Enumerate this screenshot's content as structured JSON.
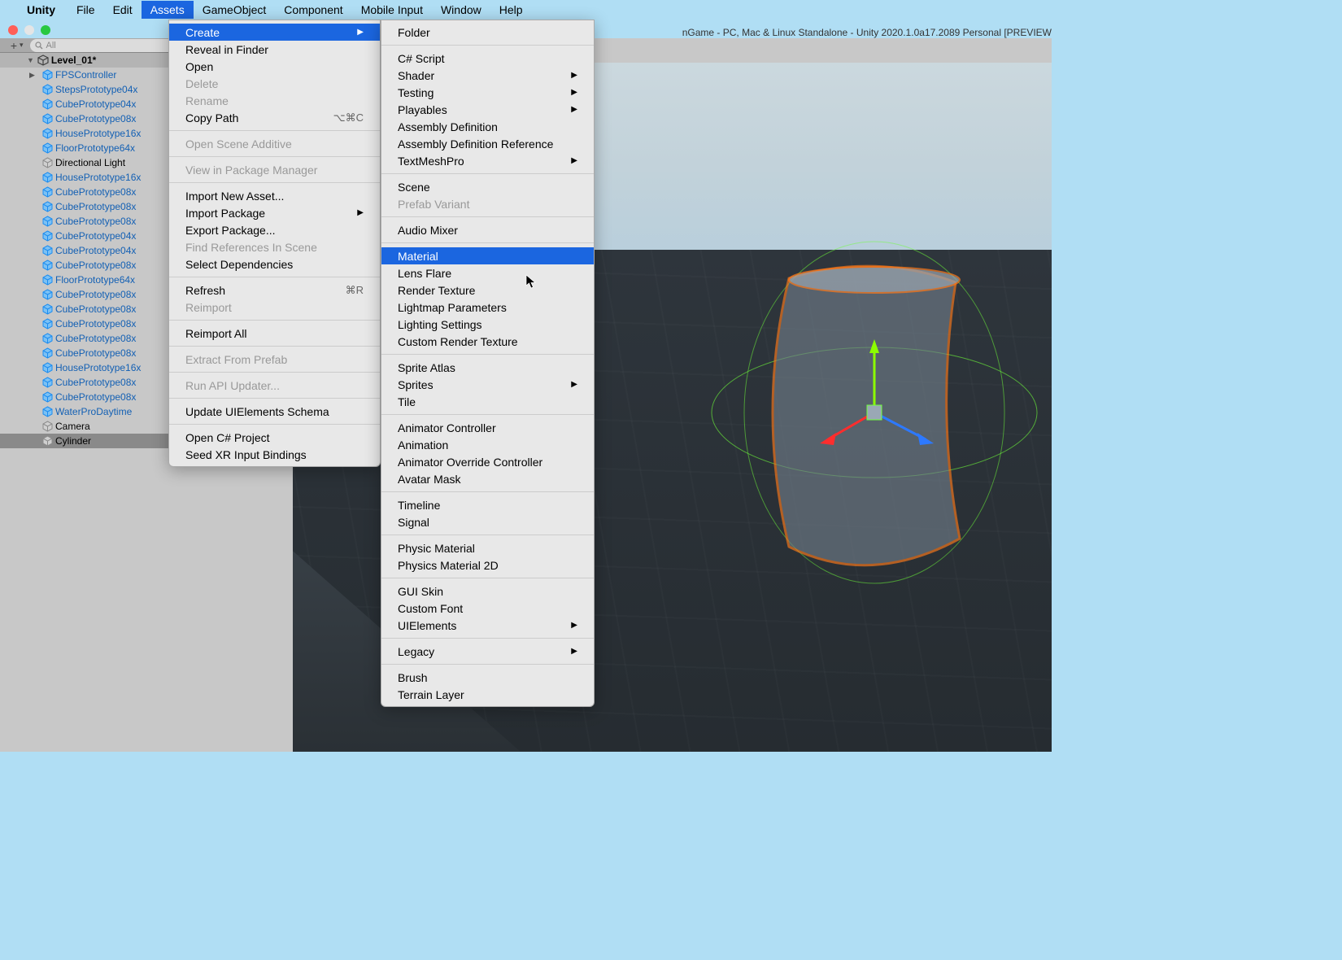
{
  "menubar": {
    "app_name": "Unity",
    "items": [
      "File",
      "Edit",
      "Assets",
      "GameObject",
      "Component",
      "Mobile Input",
      "Window",
      "Help"
    ],
    "active": "Assets"
  },
  "window_title": "nGame - PC, Mac & Linux Standalone - Unity 2020.1.0a17.2089 Personal [PREVIEW",
  "hierarchy": {
    "search_placeholder": "All",
    "scene_name": "Level_01*",
    "items": [
      {
        "label": "FPSController",
        "icon": "prefab",
        "has_children": true
      },
      {
        "label": "StepsPrototype04x",
        "icon": "prefab"
      },
      {
        "label": "CubePrototype04x",
        "icon": "prefab"
      },
      {
        "label": "CubePrototype08x",
        "icon": "prefab"
      },
      {
        "label": "HousePrototype16x",
        "icon": "prefab"
      },
      {
        "label": "FloorPrototype64x",
        "icon": "prefab"
      },
      {
        "label": "Directional Light",
        "icon": "go"
      },
      {
        "label": "HousePrototype16x",
        "icon": "prefab"
      },
      {
        "label": "CubePrototype08x",
        "icon": "prefab"
      },
      {
        "label": "CubePrototype08x",
        "icon": "prefab"
      },
      {
        "label": "CubePrototype08x",
        "icon": "prefab"
      },
      {
        "label": "CubePrototype04x",
        "icon": "prefab"
      },
      {
        "label": "CubePrototype04x",
        "icon": "prefab"
      },
      {
        "label": "CubePrototype08x",
        "icon": "prefab"
      },
      {
        "label": "FloorPrototype64x",
        "icon": "prefab"
      },
      {
        "label": "CubePrototype08x",
        "icon": "prefab"
      },
      {
        "label": "CubePrototype08x",
        "icon": "prefab"
      },
      {
        "label": "CubePrototype08x",
        "icon": "prefab"
      },
      {
        "label": "CubePrototype08x",
        "icon": "prefab"
      },
      {
        "label": "CubePrototype08x",
        "icon": "prefab"
      },
      {
        "label": "HousePrototype16x",
        "icon": "prefab"
      },
      {
        "label": "CubePrototype08x",
        "icon": "prefab"
      },
      {
        "label": "CubePrototype08x",
        "icon": "prefab"
      },
      {
        "label": "WaterProDaytime",
        "icon": "prefab"
      },
      {
        "label": "Camera",
        "icon": "go"
      },
      {
        "label": "Cylinder",
        "icon": "go",
        "selected": true
      }
    ]
  },
  "assets_menu": [
    {
      "label": "Create",
      "submenu": true,
      "highlighted": true
    },
    {
      "label": "Reveal in Finder"
    },
    {
      "label": "Open"
    },
    {
      "label": "Delete",
      "disabled": true
    },
    {
      "label": "Rename",
      "disabled": true
    },
    {
      "label": "Copy Path",
      "shortcut": "⌥⌘C"
    },
    {
      "separator": true
    },
    {
      "label": "Open Scene Additive",
      "disabled": true
    },
    {
      "separator": true
    },
    {
      "label": "View in Package Manager",
      "disabled": true
    },
    {
      "separator": true
    },
    {
      "label": "Import New Asset..."
    },
    {
      "label": "Import Package",
      "submenu": true
    },
    {
      "label": "Export Package..."
    },
    {
      "label": "Find References In Scene",
      "disabled": true
    },
    {
      "label": "Select Dependencies"
    },
    {
      "separator": true
    },
    {
      "label": "Refresh",
      "shortcut": "⌘R"
    },
    {
      "label": "Reimport",
      "disabled": true
    },
    {
      "separator": true
    },
    {
      "label": "Reimport All"
    },
    {
      "separator": true
    },
    {
      "label": "Extract From Prefab",
      "disabled": true
    },
    {
      "separator": true
    },
    {
      "label": "Run API Updater...",
      "disabled": true
    },
    {
      "separator": true
    },
    {
      "label": "Update UIElements Schema"
    },
    {
      "separator": true
    },
    {
      "label": "Open C# Project"
    },
    {
      "label": "Seed XR Input Bindings"
    }
  ],
  "create_submenu": [
    {
      "label": "Folder"
    },
    {
      "separator": true
    },
    {
      "label": "C# Script"
    },
    {
      "label": "Shader",
      "submenu": true
    },
    {
      "label": "Testing",
      "submenu": true
    },
    {
      "label": "Playables",
      "submenu": true
    },
    {
      "label": "Assembly Definition"
    },
    {
      "label": "Assembly Definition Reference"
    },
    {
      "label": "TextMeshPro",
      "submenu": true
    },
    {
      "separator": true
    },
    {
      "label": "Scene"
    },
    {
      "label": "Prefab Variant",
      "disabled": true
    },
    {
      "separator": true
    },
    {
      "label": "Audio Mixer"
    },
    {
      "separator": true
    },
    {
      "label": "Material",
      "highlighted": true
    },
    {
      "label": "Lens Flare"
    },
    {
      "label": "Render Texture"
    },
    {
      "label": "Lightmap Parameters"
    },
    {
      "label": "Lighting Settings"
    },
    {
      "label": "Custom Render Texture"
    },
    {
      "separator": true
    },
    {
      "label": "Sprite Atlas"
    },
    {
      "label": "Sprites",
      "submenu": true
    },
    {
      "label": "Tile"
    },
    {
      "separator": true
    },
    {
      "label": "Animator Controller"
    },
    {
      "label": "Animation"
    },
    {
      "label": "Animator Override Controller"
    },
    {
      "label": "Avatar Mask"
    },
    {
      "separator": true
    },
    {
      "label": "Timeline"
    },
    {
      "label": "Signal"
    },
    {
      "separator": true
    },
    {
      "label": "Physic Material"
    },
    {
      "label": "Physics Material 2D"
    },
    {
      "separator": true
    },
    {
      "label": "GUI Skin"
    },
    {
      "label": "Custom Font"
    },
    {
      "label": "UIElements",
      "submenu": true
    },
    {
      "separator": true
    },
    {
      "label": "Legacy",
      "submenu": true
    },
    {
      "separator": true
    },
    {
      "label": "Brush"
    },
    {
      "label": "Terrain Layer"
    }
  ]
}
